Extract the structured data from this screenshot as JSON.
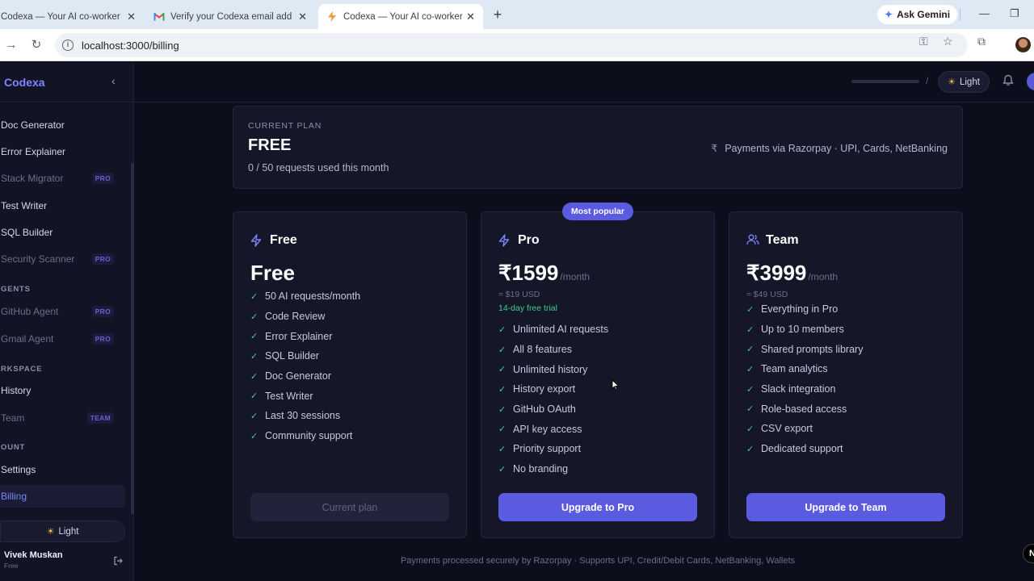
{
  "browser": {
    "tabs": [
      {
        "title": "Codexa — Your AI co-worker fo",
        "icon": "codexa-icon"
      },
      {
        "title": "Verify your Codexa email addre",
        "icon": "gmail-icon"
      },
      {
        "title": "Codexa — Your AI co-worker fo",
        "icon": "codexa-icon"
      }
    ],
    "ask_gemini": "Ask Gemini",
    "url": "localhost:3000/billing"
  },
  "sidebar": {
    "brand": "Codexa",
    "items": [
      {
        "label": "Doc Generator",
        "badge": ""
      },
      {
        "label": "Error Explainer",
        "badge": ""
      },
      {
        "label": "Stack Migrator",
        "badge": "PRO"
      },
      {
        "label": "Test Writer",
        "badge": ""
      },
      {
        "label": "SQL Builder",
        "badge": ""
      },
      {
        "label": "Security Scanner",
        "badge": "PRO"
      }
    ],
    "sections": {
      "agents": "GENTS",
      "workspace": "RKSPACE",
      "account": "OUNT"
    },
    "agents": [
      {
        "label": "GitHub Agent",
        "badge": "PRO"
      },
      {
        "label": "Gmail Agent",
        "badge": "PRO"
      }
    ],
    "workspace": [
      {
        "label": "History",
        "badge": ""
      },
      {
        "label": "Team",
        "badge": "TEAM"
      }
    ],
    "account": [
      {
        "label": "Settings",
        "badge": ""
      },
      {
        "label": "Billing",
        "badge": ""
      }
    ],
    "theme_toggle": "Light",
    "user": {
      "name": "Vivek Muskan",
      "plan": "Free"
    }
  },
  "topbar": {
    "separator": "/",
    "theme_label": "Light"
  },
  "current_plan": {
    "label": "CURRENT PLAN",
    "name": "FREE",
    "usage": "0 / 50 requests used this month",
    "rupee": "₹",
    "payment_note": "Payments via Razorpay · UPI, Cards, NetBanking"
  },
  "plans": [
    {
      "name": "Free",
      "price": "Free",
      "period": "",
      "usd": "",
      "trial": "",
      "features": [
        "50 AI requests/month",
        "Code Review",
        "Error Explainer",
        "SQL Builder",
        "Doc Generator",
        "Test Writer",
        "Last 30 sessions",
        "Community support"
      ],
      "cta": "Current plan"
    },
    {
      "name": "Pro",
      "badge": "Most popular",
      "price": "₹1599",
      "period": "/month",
      "usd": "≈ $19 USD",
      "trial": "14-day free trial",
      "features": [
        "Unlimited AI requests",
        "All 8 features",
        "Unlimited history",
        "History export",
        "GitHub OAuth",
        "API key access",
        "Priority support",
        "No branding"
      ],
      "cta": "Upgrade to Pro"
    },
    {
      "name": "Team",
      "price": "₹3999",
      "period": "/month",
      "usd": "≈ $49 USD",
      "trial": "",
      "features": [
        "Everything in Pro",
        "Up to 10 members",
        "Shared prompts library",
        "Team analytics",
        "Slack integration",
        "Role-based access",
        "CSV export",
        "Dedicated support"
      ],
      "cta": "Upgrade to Team"
    }
  ],
  "footer": "Payments processed securely by Razorpay · Supports UPI, Credit/Debit Cards, NetBanking, Wallets",
  "colors": {
    "accent": "#5a5be0",
    "brand": "#7d86ff",
    "check": "#3ecf8e",
    "background": "#0d0e1c",
    "card": "#151628"
  }
}
